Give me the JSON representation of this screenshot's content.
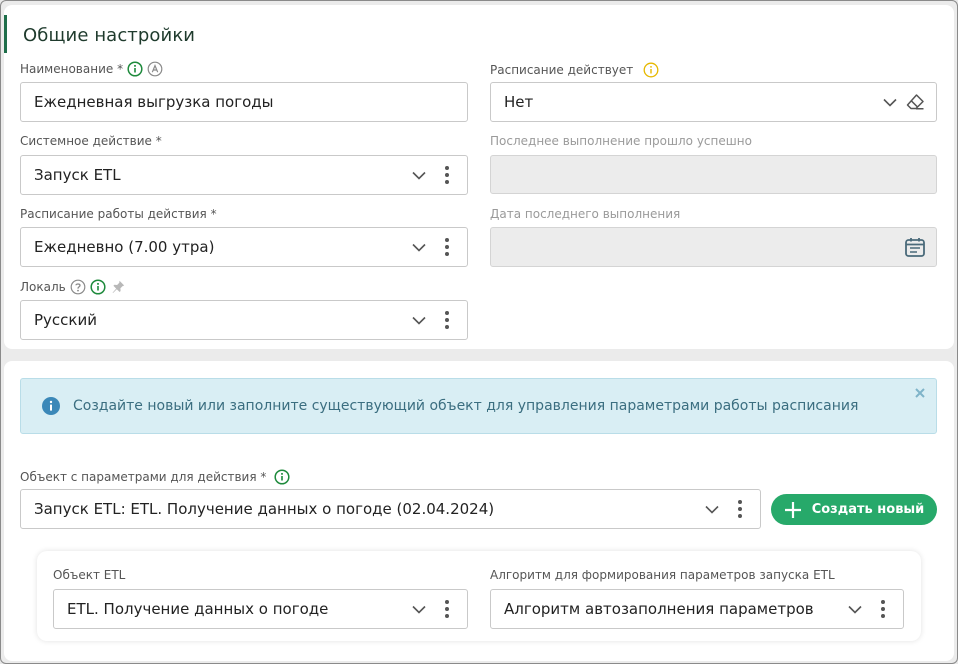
{
  "section": {
    "title": "Общие настройки"
  },
  "fields": {
    "name": {
      "label": "Наименование *",
      "value": "Ежедневная выгрузка погоды"
    },
    "system_action": {
      "label": "Системное действие *",
      "value": "Запуск ETL"
    },
    "schedule": {
      "label": "Расписание работы действия *",
      "value": "Ежедневно (7.00 утра)"
    },
    "locale": {
      "label": "Локаль",
      "value": "Русский"
    },
    "schedule_active": {
      "label": "Расписание действует",
      "value": "Нет"
    },
    "last_success": {
      "label": "Последнее выполнение прошло успешно",
      "value": ""
    },
    "last_date": {
      "label": "Дата последнего выполнения",
      "value": ""
    }
  },
  "info": {
    "text": "Создайте новый или заполните существующий объект для управления параметрами работы расписания"
  },
  "params_object": {
    "label": "Объект с параметрами для действия *",
    "value": "Запуск ETL: ETL. Получение данных о погоде (02.04.2024)"
  },
  "create_button": {
    "label": "Создать новый"
  },
  "etl": {
    "object": {
      "label": "Объект ETL",
      "value": "ETL. Получение данных о погоде"
    },
    "algorithm": {
      "label": "Алгоритм для формирования параметров запуска ETL",
      "value": "Алгоритм автозаполнения параметров"
    }
  },
  "colors": {
    "accent": "#27a96a",
    "info_bg": "#d9eef4",
    "info_text": "#3b6e80",
    "warning": "#e6b800",
    "success_icon": "#1e8a3c"
  }
}
